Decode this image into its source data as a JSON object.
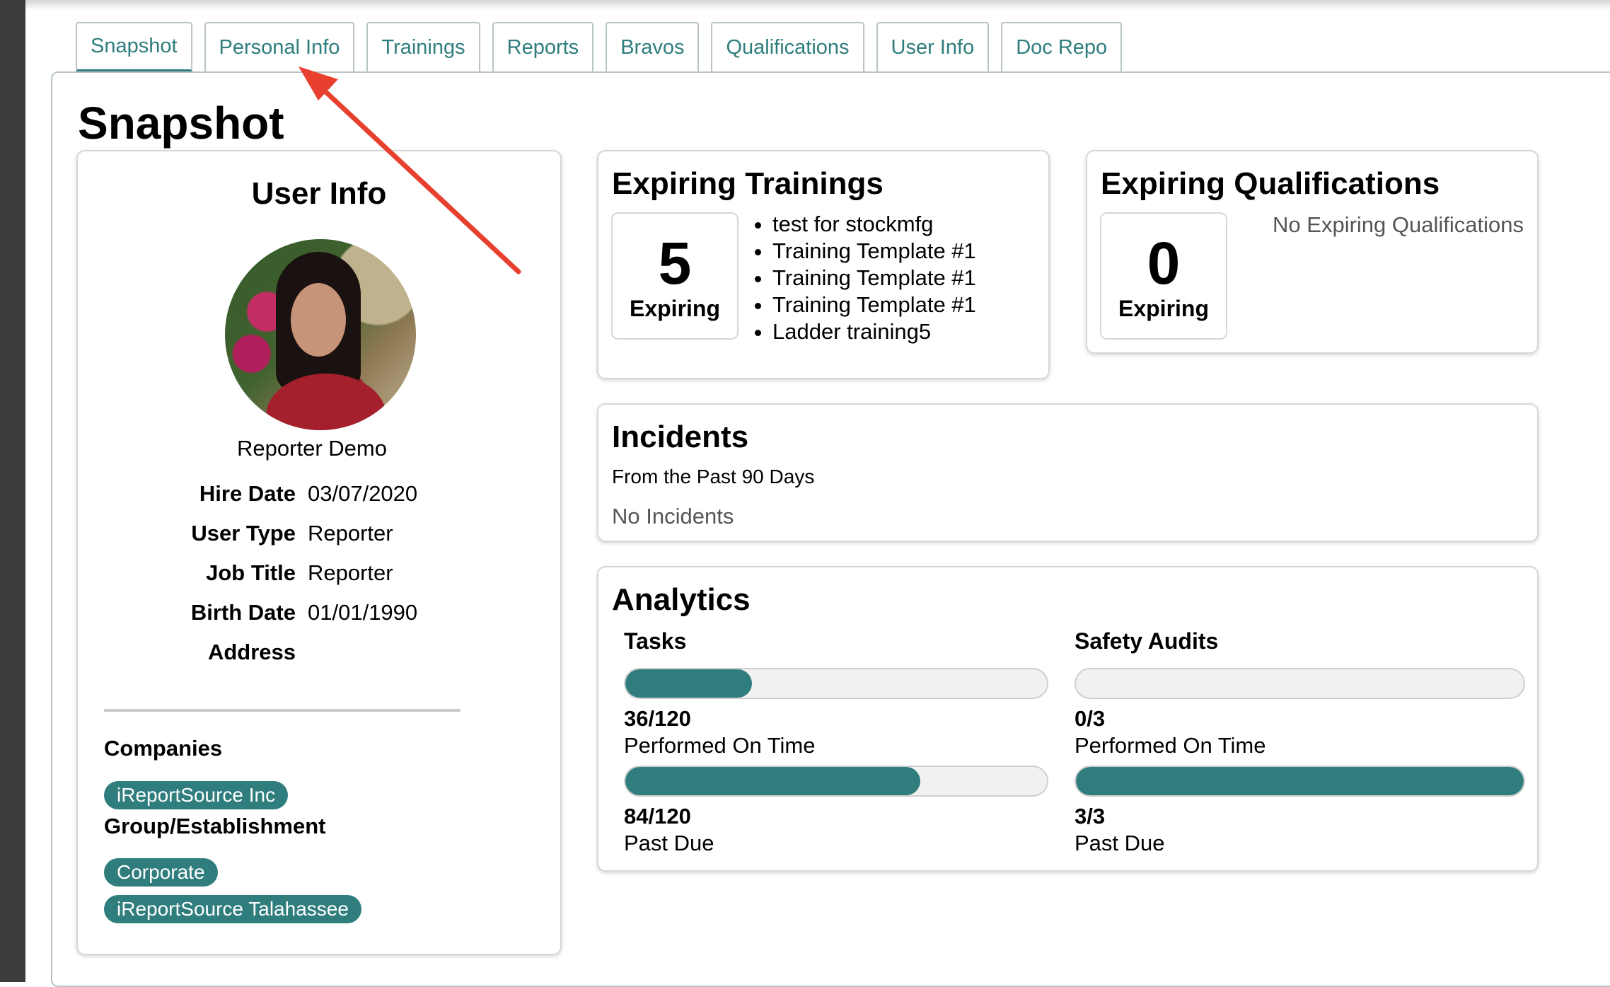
{
  "tabs": [
    {
      "label": "Snapshot",
      "active": true
    },
    {
      "label": "Personal Info",
      "active": false
    },
    {
      "label": "Trainings",
      "active": false
    },
    {
      "label": "Reports",
      "active": false
    },
    {
      "label": "Bravos",
      "active": false
    },
    {
      "label": "Qualifications",
      "active": false
    },
    {
      "label": "User Info",
      "active": false
    },
    {
      "label": "Doc Repo",
      "active": false
    }
  ],
  "page_title": "Snapshot",
  "user_info": {
    "title": "User Info",
    "name": "Reporter Demo",
    "fields": [
      {
        "label": "Hire Date",
        "value": "03/07/2020"
      },
      {
        "label": "User Type",
        "value": "Reporter"
      },
      {
        "label": "Job Title",
        "value": "Reporter"
      },
      {
        "label": "Birth Date",
        "value": "01/01/1990"
      },
      {
        "label": "Address",
        "value": ""
      }
    ],
    "companies_label": "Companies",
    "companies": [
      "iReportSource Inc"
    ],
    "group_label": "Group/Establishment",
    "groups": [
      "Corporate",
      "iReportSource Talahassee"
    ]
  },
  "expiring_trainings": {
    "title": "Expiring Trainings",
    "count": "5",
    "count_label": "Expiring",
    "items": [
      "test for stockmfg",
      "Training Template #1",
      "Training Template #1",
      "Training Template #1",
      "Ladder training5"
    ]
  },
  "expiring_qualifications": {
    "title": "Expiring Qualifications",
    "count": "0",
    "count_label": "Expiring",
    "empty_text": "No Expiring Qualifications"
  },
  "incidents": {
    "title": "Incidents",
    "subtitle": "From the Past 90 Days",
    "empty_text": "No Incidents"
  },
  "analytics": {
    "title": "Analytics",
    "tasks": {
      "title": "Tasks",
      "on_time": {
        "count": "36/120",
        "label": "Performed On Time",
        "done": 36,
        "total": 120
      },
      "past_due": {
        "count": "84/120",
        "label": "Past Due",
        "done": 84,
        "total": 120
      }
    },
    "safety_audits": {
      "title": "Safety Audits",
      "on_time": {
        "count": "0/3",
        "label": "Performed On Time",
        "done": 0,
        "total": 3
      },
      "past_due": {
        "count": "3/3",
        "label": "Past Due",
        "done": 3,
        "total": 3
      }
    }
  },
  "colors": {
    "accent": "#2f7d7d",
    "annotation_arrow": "#e8402f"
  }
}
